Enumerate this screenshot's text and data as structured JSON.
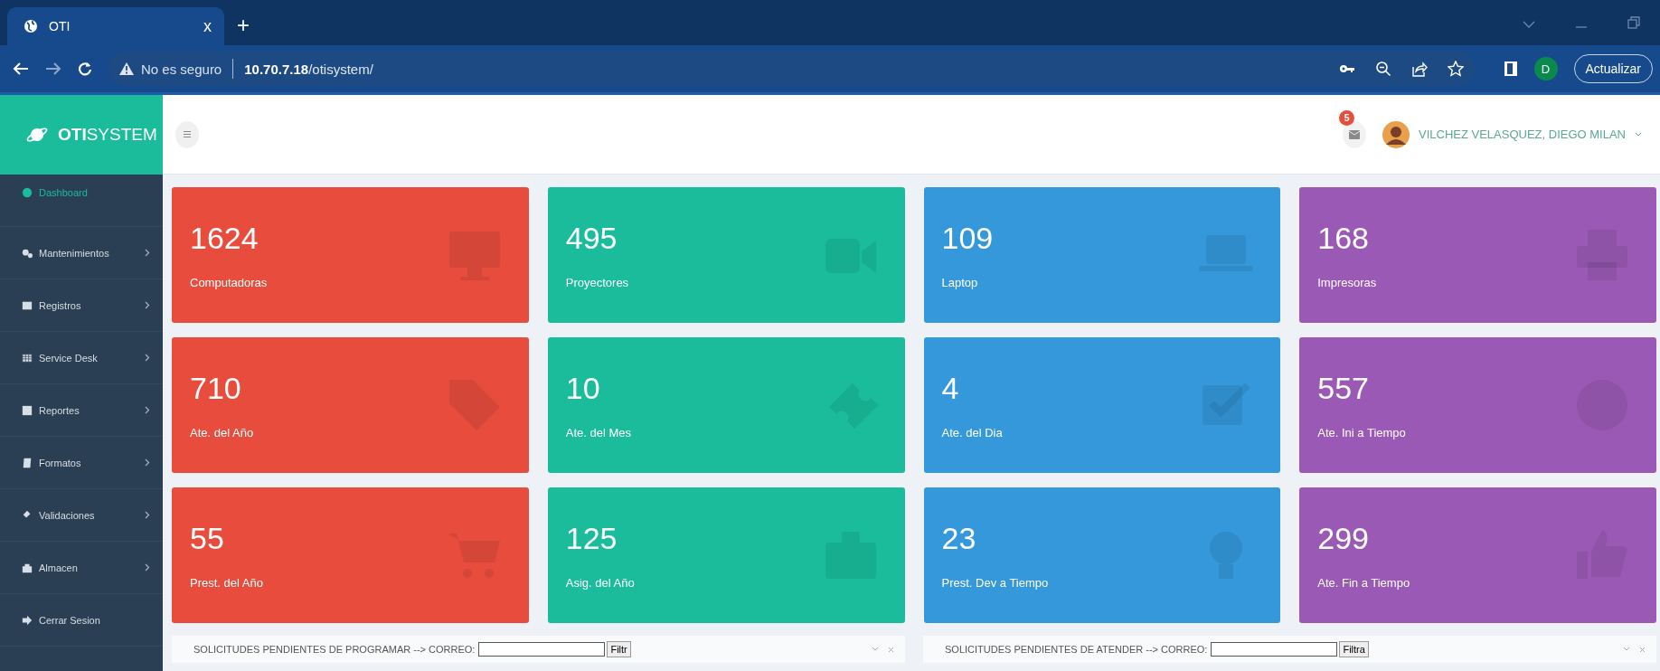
{
  "browser": {
    "tab": {
      "title": "OTI",
      "close": "x",
      "selected": true
    },
    "new_tab": "+",
    "address": {
      "warning": "No es seguro",
      "host": "10.70.7.18",
      "path": "/otisystem/"
    },
    "profile": "D",
    "update_button": "Actualizar"
  },
  "header": {
    "brand": "**OTI**SYSTEM",
    "notifications": "5",
    "user": "VILCHEZ VELASQUEZ, DIEGO MILAN"
  },
  "sidebar": {
    "items": [
      {
        "label": "Dashboard",
        "selected": true,
        "submenu": false
      },
      {
        "label": "Mantenimientos",
        "selected": false,
        "submenu": true
      },
      {
        "label": "Registros",
        "selected": false,
        "submenu": true
      },
      {
        "label": "Service Desk",
        "selected": false,
        "submenu": true
      },
      {
        "label": "Reportes",
        "selected": false,
        "submenu": true
      },
      {
        "label": "Formatos",
        "selected": false,
        "submenu": true
      },
      {
        "label": "Validaciones",
        "selected": false,
        "submenu": true
      },
      {
        "label": "Almacen",
        "selected": false,
        "submenu": true
      },
      {
        "label": "Cerrar Sesion",
        "selected": false,
        "submenu": false
      }
    ]
  },
  "tiles": [
    {
      "value": "1624",
      "label": "Computadoras",
      "color": "#e74c3c"
    },
    {
      "value": "495",
      "label": "Proyectores",
      "color": "#1abc9c"
    },
    {
      "value": "109",
      "label": "Laptop",
      "color": "#3498db"
    },
    {
      "value": "168",
      "label": "Impresoras",
      "color": "#9b59b6"
    },
    {
      "value": "710",
      "label": "Ate. del Año",
      "color": "#e74c3c"
    },
    {
      "value": "10",
      "label": "Ate. del Mes",
      "color": "#1abc9c"
    },
    {
      "value": "4",
      "label": "Ate. del Dia",
      "color": "#3498db"
    },
    {
      "value": "557",
      "label": "Ate. Ini a Tiempo",
      "color": "#9b59b6"
    },
    {
      "value": "55",
      "label": "Prest. del Año",
      "color": "#e74c3c"
    },
    {
      "value": "125",
      "label": "Asig. del Año",
      "color": "#1abc9c"
    },
    {
      "value": "23",
      "label": "Prest. Dev a Tiempo",
      "color": "#3498db"
    },
    {
      "value": "299",
      "label": "Ate. Fin a Tiempo",
      "color": "#9b59b6"
    }
  ],
  "panels": [
    {
      "title": "SOLICITUDES PENDIENTES DE PROGRAMAR --> CORREO:",
      "button": "Filtr"
    },
    {
      "title": "SOLICITUDES PENDIENTES DE ATENDER --> CORREO:",
      "button": "Filtra"
    }
  ]
}
